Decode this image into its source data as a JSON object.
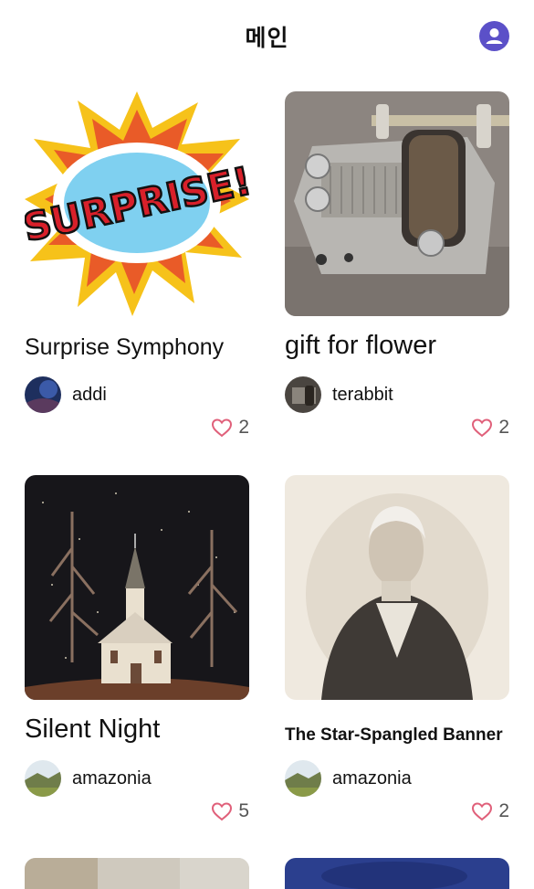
{
  "header": {
    "title": "메인",
    "profile_icon": "user-circle-icon",
    "accent": "#5b50c8"
  },
  "cards": [
    {
      "title": "Surprise Symphony",
      "author": "addi",
      "likes": "2",
      "image": "surprise-comic-burst"
    },
    {
      "title": "gift for flower",
      "author": "terabbit",
      "likes": "2",
      "image": "music-box-mechanism"
    },
    {
      "title": "Silent Night",
      "author": "amazonia",
      "likes": "5",
      "image": "church-night-scene"
    },
    {
      "title": "The Star-Spangled Banner",
      "author": "amazonia",
      "likes": "2",
      "image": "portrait-engraving"
    }
  ],
  "colors": {
    "heart": "#e0607a",
    "text": "#111111",
    "muted": "#555555"
  }
}
